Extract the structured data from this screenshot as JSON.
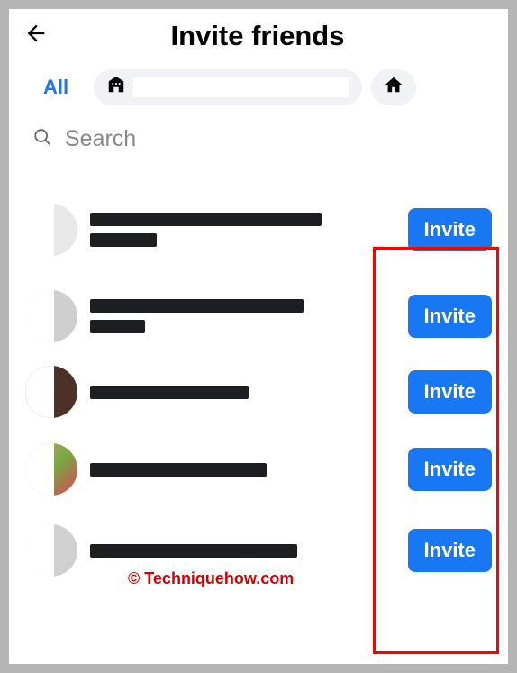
{
  "header": {
    "title": "Invite friends"
  },
  "filters": {
    "all_label": "All"
  },
  "search": {
    "placeholder": "Search"
  },
  "buttons": {
    "invite_label": "Invite"
  },
  "watermark": "© Techniquehow.com",
  "friends": [
    {
      "id": 1,
      "invite_label": "Invite"
    },
    {
      "id": 2,
      "invite_label": "Invite"
    },
    {
      "id": 3,
      "invite_label": "Invite"
    },
    {
      "id": 4,
      "invite_label": "Invite"
    },
    {
      "id": 5,
      "invite_label": "Invite"
    }
  ]
}
